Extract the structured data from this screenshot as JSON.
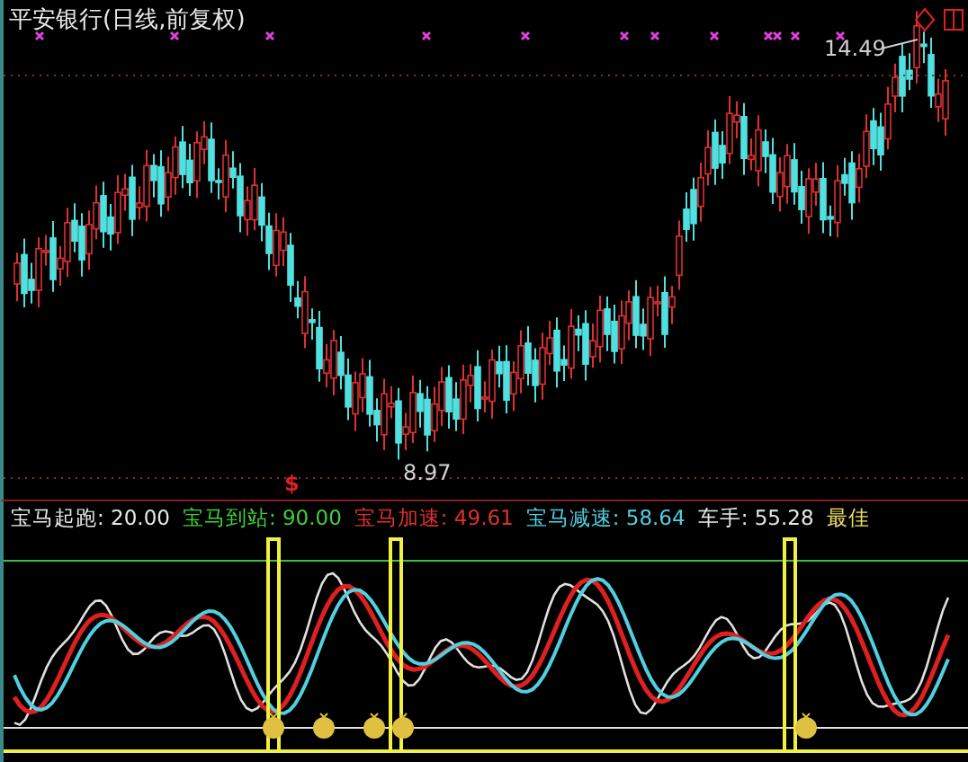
{
  "chart_title": "平安银行(日线,前复权)",
  "price_labels": {
    "high": "14.49",
    "low": "8.97"
  },
  "signal_mark": "$",
  "indicator_legend": [
    {
      "label": "宝马起跑:",
      "value": "20.00",
      "color": "#e8e8e8"
    },
    {
      "label": "宝马到站:",
      "value": "90.00",
      "color": "#3cd23c"
    },
    {
      "label": "宝马加速:",
      "value": "49.61",
      "color": "#e03030"
    },
    {
      "label": "宝马减速:",
      "value": "58.64",
      "color": "#50d0e0"
    },
    {
      "label": "车手:",
      "value": "55.28",
      "color": "#e8e8e8"
    },
    {
      "label": "最佳",
      "color": "#f0e060"
    }
  ]
}
